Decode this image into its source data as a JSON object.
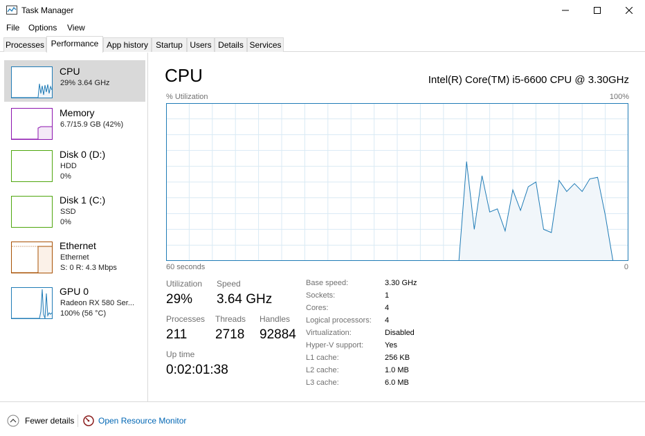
{
  "window": {
    "title": "Task Manager",
    "icon": "task-manager-icon",
    "controls": [
      "minimize-icon",
      "maximize-icon",
      "close-icon"
    ]
  },
  "menu": [
    "File",
    "Options",
    "View"
  ],
  "tabs": [
    "Processes",
    "Performance",
    "App history",
    "Startup",
    "Users",
    "Details",
    "Services"
  ],
  "active_tab": "Performance",
  "sidebar": {
    "items": [
      {
        "title": "CPU",
        "lines": [
          "29%  3.64 GHz"
        ],
        "color": "#1f7bb6",
        "selected": true
      },
      {
        "title": "Memory",
        "lines": [
          "6.7/15.9 GB (42%)"
        ],
        "color": "#8b12ae",
        "selected": false
      },
      {
        "title": "Disk 0 (D:)",
        "lines": [
          "HDD",
          "0%"
        ],
        "color": "#4da60c",
        "selected": false
      },
      {
        "title": "Disk 1 (C:)",
        "lines": [
          "SSD",
          "0%"
        ],
        "color": "#4da60c",
        "selected": false
      },
      {
        "title": "Ethernet",
        "lines": [
          "Ethernet",
          "S: 0  R: 4.3 Mbps"
        ],
        "color": "#a74f01",
        "selected": false
      },
      {
        "title": "GPU 0",
        "lines": [
          "Radeon RX 580 Ser...",
          "100%  (56 °C)"
        ],
        "color": "#1f7bb6",
        "selected": false
      }
    ]
  },
  "main": {
    "heading": "CPU",
    "model": "Intel(R) Core(TM) i5-6600 CPU @ 3.30GHz",
    "graph": {
      "y_label": "% Utilization",
      "y_max_label": "100%",
      "x_label": "60 seconds",
      "x_min_label": "0",
      "line_color": "#1f7bb6",
      "fill_color": "#f1f6fa",
      "grid_color": "#d9eaf4"
    },
    "stats": {
      "utilization": {
        "label": "Utilization",
        "value": "29%"
      },
      "speed": {
        "label": "Speed",
        "value": "3.64 GHz"
      },
      "processes": {
        "label": "Processes",
        "value": "211"
      },
      "threads": {
        "label": "Threads",
        "value": "2718"
      },
      "handles": {
        "label": "Handles",
        "value": "92884"
      },
      "uptime": {
        "label": "Up time",
        "value": "0:02:01:38"
      }
    },
    "specs": [
      {
        "label": "Base speed:",
        "value": "3.30 GHz"
      },
      {
        "label": "Sockets:",
        "value": "1"
      },
      {
        "label": "Cores:",
        "value": "4"
      },
      {
        "label": "Logical processors:",
        "value": "4"
      },
      {
        "label": "Virtualization:",
        "value": "Disabled"
      },
      {
        "label": "Hyper-V support:",
        "value": "Yes"
      },
      {
        "label": "L1 cache:",
        "value": "256 KB"
      },
      {
        "label": "L2 cache:",
        "value": "1.0 MB"
      },
      {
        "label": "L3 cache:",
        "value": "6.0 MB"
      }
    ]
  },
  "footer": {
    "fewer_details": "Fewer details",
    "open_monitor": "Open Resource Monitor"
  },
  "chart_data": {
    "type": "area",
    "x": [
      60,
      59,
      58,
      57,
      56,
      55,
      54,
      53,
      52,
      51,
      50,
      49,
      48,
      47,
      46,
      45,
      44,
      43,
      42,
      41,
      40,
      39,
      38,
      37,
      36,
      35,
      34,
      33,
      32,
      31,
      30,
      29,
      28,
      27,
      26,
      25,
      24,
      23,
      22,
      21,
      20,
      19,
      18,
      17,
      16,
      15,
      14,
      13,
      12,
      11,
      10,
      9,
      8,
      7,
      6,
      5,
      4,
      3,
      2,
      1,
      0
    ],
    "values": [
      0,
      0,
      0,
      0,
      0,
      0,
      0,
      0,
      0,
      0,
      0,
      0,
      0,
      0,
      0,
      0,
      0,
      0,
      0,
      0,
      0,
      0,
      0,
      0,
      0,
      0,
      0,
      0,
      0,
      0,
      0,
      0,
      0,
      0,
      0,
      0,
      0,
      0,
      0,
      63,
      20,
      54,
      31,
      33,
      19,
      45,
      32,
      47,
      50,
      20,
      18,
      51,
      44,
      49,
      44,
      52,
      53,
      29,
      0,
      0,
      0
    ],
    "x_range": [
      60,
      0
    ],
    "ylim": [
      0,
      100
    ],
    "grid": true
  }
}
